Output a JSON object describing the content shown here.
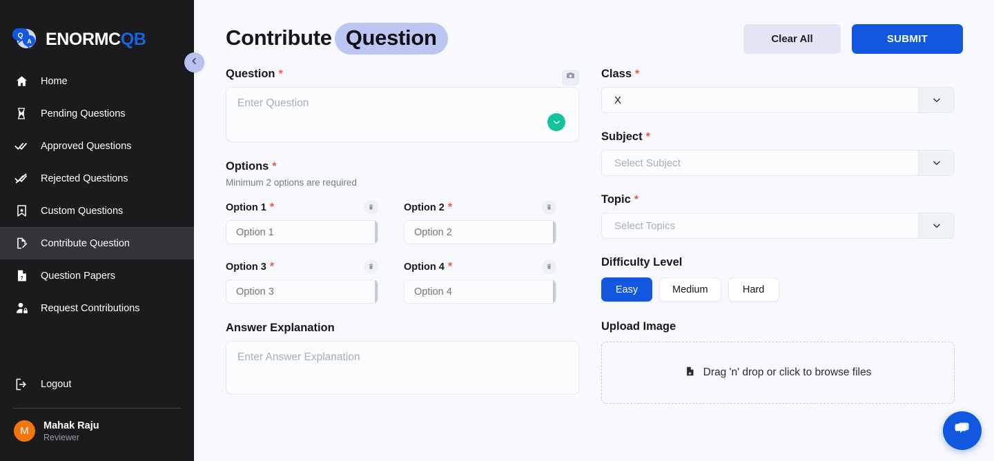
{
  "brand": {
    "name_white": "ENORMC",
    "name_blue": "QB",
    "logo_icon": "qa-bubbles-logo",
    "accent_blue": "#1157e0"
  },
  "sidebar": {
    "items": [
      {
        "label": "Home",
        "icon": "home-icon",
        "active": false
      },
      {
        "label": "Pending Questions",
        "icon": "hourglass-icon",
        "active": false
      },
      {
        "label": "Approved Questions",
        "icon": "double-check-icon",
        "active": false
      },
      {
        "label": "Rejected Questions",
        "icon": "double-check-crossed-icon",
        "active": false
      },
      {
        "label": "Custom Questions",
        "icon": "bookmark-star-icon",
        "active": false
      },
      {
        "label": "Contribute Question",
        "icon": "file-pencil-icon",
        "active": true
      },
      {
        "label": "Question Papers",
        "icon": "file-question-icon",
        "active": false
      },
      {
        "label": "Request Contributions",
        "icon": "user-lock-icon",
        "active": false
      }
    ],
    "logout": {
      "label": "Logout",
      "icon": "logout-icon"
    },
    "user": {
      "initial": "M",
      "name": "Mahak Raju",
      "role": "Reviewer",
      "avatar_color": "#f2760c"
    },
    "collapse_icon": "chevron-left-icon"
  },
  "header": {
    "title_plain": "Contribute",
    "title_highlight": "Question",
    "highlight_color": "#bcc6f2",
    "clear_label": "Clear All",
    "submit_label": "SUBMIT"
  },
  "form": {
    "question": {
      "label": "Question",
      "required": "*",
      "placeholder": "Enter Question",
      "camera_icon": "camera-icon",
      "assistant_icon": "grammarly-icon",
      "assistant_color": "#15c39a"
    },
    "options": {
      "label": "Options",
      "required": "*",
      "hint": "Minimum 2 options are required",
      "items": [
        {
          "label": "Option 1",
          "required": "*",
          "placeholder": "Option 1",
          "delete_icon": "trash-icon",
          "check_icon": "check-icon"
        },
        {
          "label": "Option 2",
          "required": "*",
          "placeholder": "Option 2",
          "delete_icon": "trash-icon",
          "check_icon": "check-icon"
        },
        {
          "label": "Option 3",
          "required": "*",
          "placeholder": "Option 3",
          "delete_icon": "trash-icon",
          "check_icon": "check-icon"
        },
        {
          "label": "Option 4",
          "required": "*",
          "placeholder": "Option 4",
          "delete_icon": "trash-icon",
          "check_icon": "check-icon"
        }
      ]
    },
    "answer_explanation": {
      "label": "Answer Explanation",
      "placeholder": "Enter Answer Explanation"
    },
    "class": {
      "label": "Class",
      "required": "*",
      "value": "X",
      "arrow_icon": "chevron-down-icon"
    },
    "subject": {
      "label": "Subject",
      "required": "*",
      "placeholder": "Select Subject",
      "arrow_icon": "chevron-down-icon"
    },
    "topic": {
      "label": "Topic",
      "required": "*",
      "placeholder": "Select Topics",
      "arrow_icon": "chevron-down-icon"
    },
    "difficulty": {
      "label": "Difficulty Level",
      "options": [
        "Easy",
        "Medium",
        "Hard"
      ],
      "selected": "Easy"
    },
    "upload": {
      "label": "Upload Image",
      "dropzone_text": "Drag 'n' drop or click to browse files",
      "file_icon": "file-add-icon"
    }
  },
  "chat_widget": {
    "icon": "chat-bubbles-icon",
    "color": "#1157e0"
  }
}
